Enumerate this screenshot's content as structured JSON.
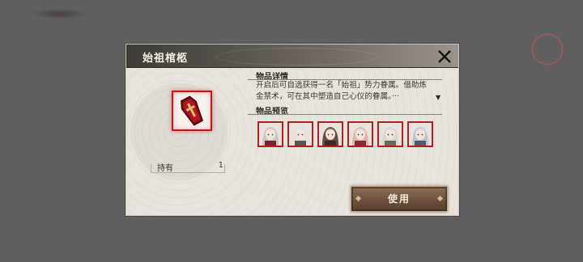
{
  "dialog": {
    "title": "始祖棺柩",
    "close_icon": "close-x-icon"
  },
  "item": {
    "icon": "coffin-icon",
    "held_label": "持有",
    "held_value": "1"
  },
  "details": {
    "section_title": "物品详情",
    "description_line1": "开启后可自选获得一名「始祖」势力眷属。借助炼",
    "description_line2": "金禁术，可在其中塑造自己心仪的眷属。···",
    "scroll_icon": "▼"
  },
  "preview": {
    "section_title": "物品预览",
    "avatars": [
      {
        "name": "character-avatar-1",
        "hair": "#c9c4c6",
        "accent": "#7a1f2c"
      },
      {
        "name": "character-avatar-2",
        "hair": "#e2e0dc",
        "accent": "#5a5452"
      },
      {
        "name": "character-avatar-3",
        "hair": "#6b4a3c",
        "accent": "#3b2a25"
      },
      {
        "name": "character-avatar-4",
        "hair": "#d8b7a6",
        "accent": "#7c2f33"
      },
      {
        "name": "character-avatar-5",
        "hair": "#d9d4cb",
        "accent": "#6a6862"
      },
      {
        "name": "character-avatar-6",
        "hair": "#bfc6d2",
        "accent": "#505a6e"
      }
    ]
  },
  "actions": {
    "use_label": "使用"
  },
  "colors": {
    "frame_red": "#b31e1e",
    "button_brown": "#6a4f3a"
  }
}
